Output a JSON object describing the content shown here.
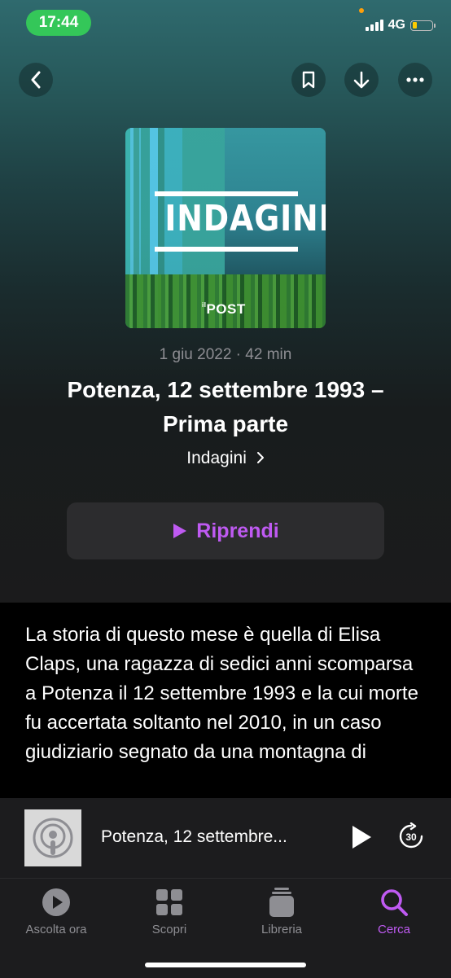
{
  "status_bar": {
    "time": "17:44",
    "network": "4G",
    "time_pill_color": "#34c759",
    "battery_color": "#ffcc00"
  },
  "header": {
    "back_icon": "chevron-left-icon",
    "bookmark_icon": "bookmark-icon",
    "download_icon": "arrow-down-icon",
    "more_icon": "ellipsis-icon"
  },
  "artwork": {
    "title": "INDAGINI",
    "brand": "POST",
    "brand_prefix": "il"
  },
  "episode": {
    "meta": "1 giu 2022 · 42 min",
    "title": "Potenza, 12 settembre 1993 – Prima parte",
    "show": "Indagini",
    "resume_label": "Riprendi",
    "accent_color": "#bf5af2",
    "description": "La storia di questo mese è quella di Elisa Claps, una ragazza di sedici anni scomparsa a Potenza il 12 settembre 1993 e la cui morte fu accertata soltanto nel 2010, in un caso giudiziario segnato da una montagna di"
  },
  "mini_player": {
    "title": "Potenza, 12 settembre...",
    "skip_seconds": "30",
    "artwork_icon": "podcasts-icon"
  },
  "tabs": [
    {
      "label": "Ascolta ora",
      "icon": "play-circle-icon",
      "active": false
    },
    {
      "label": "Scopri",
      "icon": "grid-icon",
      "active": false
    },
    {
      "label": "Libreria",
      "icon": "library-icon",
      "active": false
    },
    {
      "label": "Cerca",
      "icon": "search-icon",
      "active": true
    }
  ]
}
